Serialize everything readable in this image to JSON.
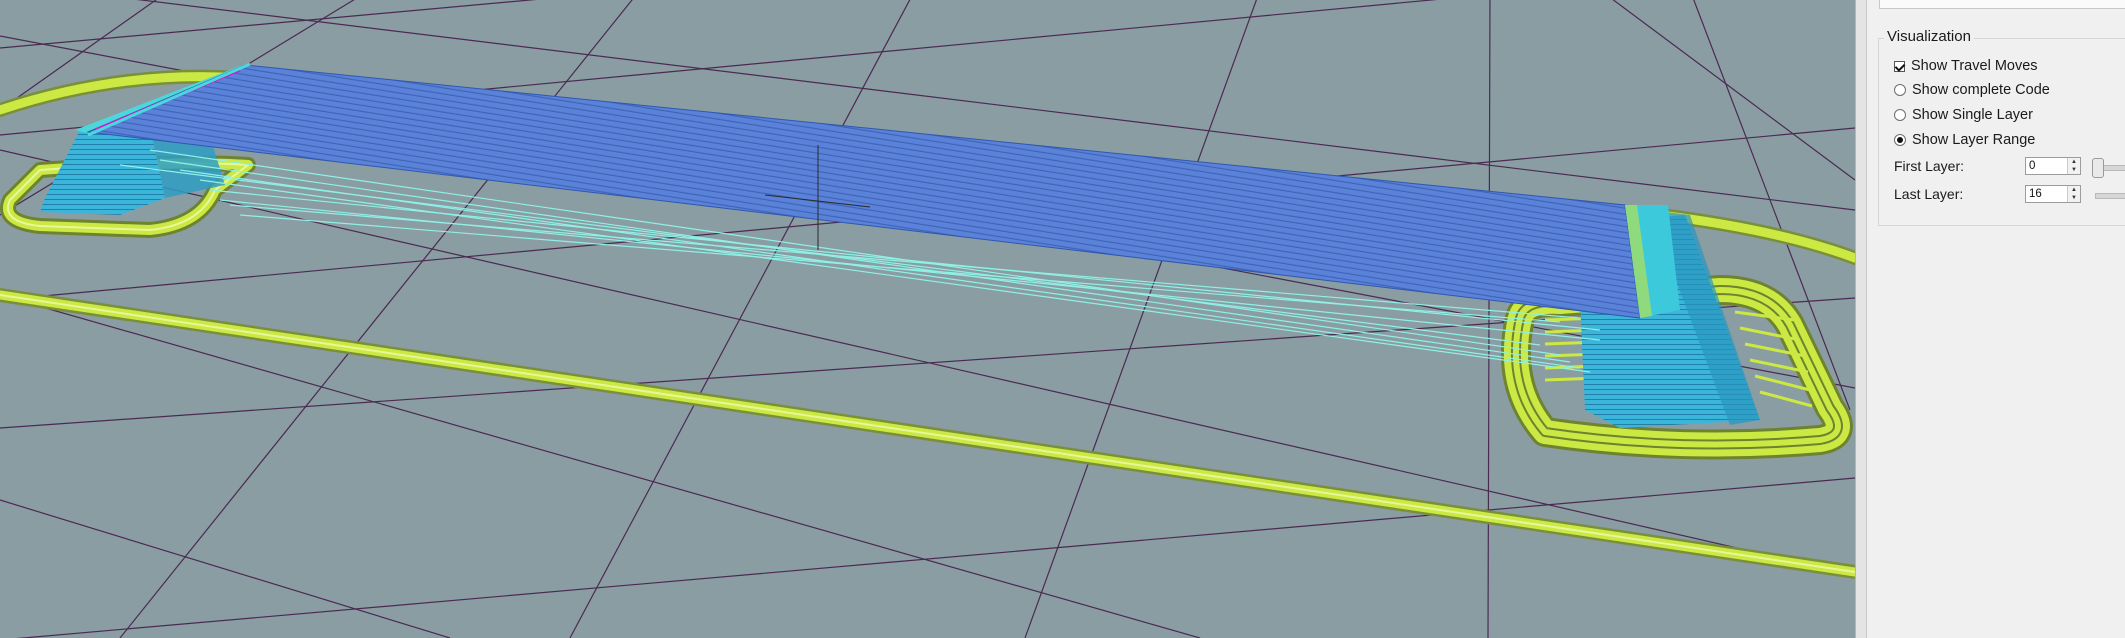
{
  "visualization": {
    "title": "Visualization",
    "options": [
      {
        "label": "Show Travel Moves",
        "type": "checkbox",
        "checked": true
      },
      {
        "label": "Show complete Code",
        "type": "radio",
        "checked": false
      },
      {
        "label": "Show Single Layer",
        "type": "radio",
        "checked": false
      },
      {
        "label": "Show Layer Range",
        "type": "radio",
        "checked": true
      }
    ],
    "first_layer_label": "First Layer:",
    "first_layer_value": "0",
    "last_layer_label": "Last Layer:",
    "last_layer_value": "16"
  },
  "colors": {
    "background": "#8a9da3",
    "grid": "#4b2a52",
    "skirt": "#c7e63d",
    "infill_top": "#5b83d9",
    "walls": "#38b7d8",
    "travel": "#8ff0e6",
    "highlight": "#cc1fd0"
  }
}
